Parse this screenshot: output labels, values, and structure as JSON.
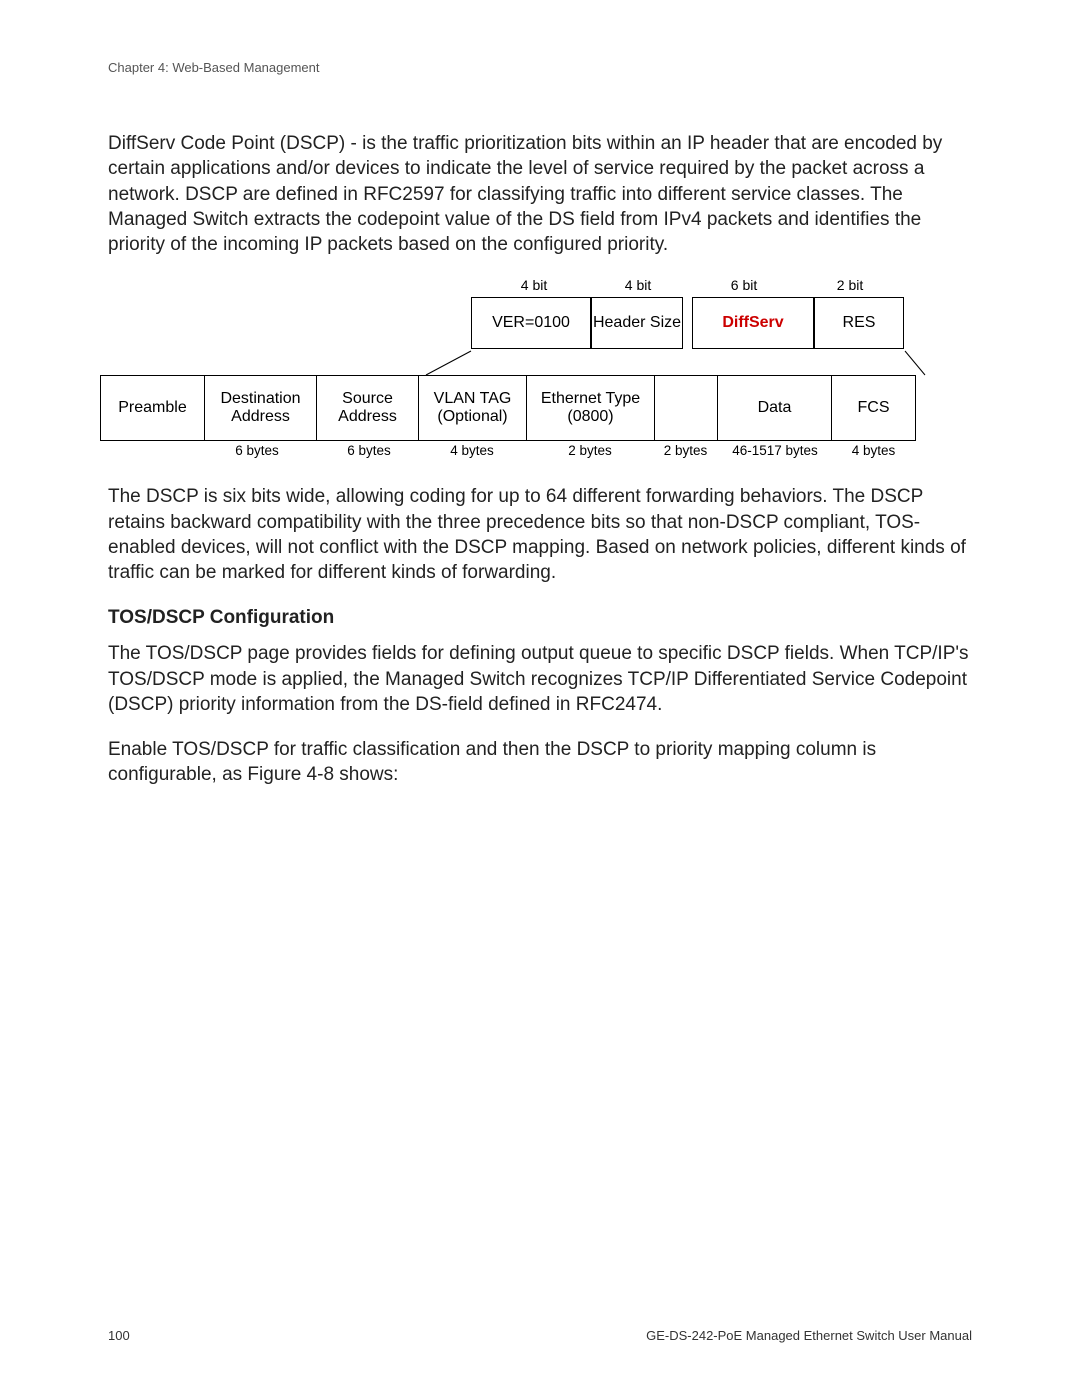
{
  "header": {
    "chapter": "Chapter 4: Web-Based Management"
  },
  "para1": "DiffServ Code Point (DSCP) - is the traffic prioritization bits within an IP header that are encoded by certain applications and/or devices to indicate the level of service required by the packet across a network. DSCP are defined in RFC2597 for classifying traffic into different service classes. The Managed Switch extracts the codepoint value of the DS field from IPv4 packets and identifies the priority of the incoming IP packets based on the configured priority.",
  "diagram": {
    "top_bits": {
      "a": "4 bit",
      "b": "4 bit",
      "c": "6 bit",
      "d": "2 bit"
    },
    "top_cells": {
      "ver": "VER=0100",
      "hsize": "Header Size",
      "ds": "DiffServ",
      "res": "RES"
    },
    "bottom_cells": {
      "pre": "Preamble",
      "dest": "Destination Address",
      "src": "Source Address",
      "vlan": "VLAN TAG (Optional)",
      "eth": "Ethernet Type (0800)",
      "data": "Data",
      "fcs": "FCS"
    },
    "bottom_bytes": {
      "dest": "6 bytes",
      "src": "6 bytes",
      "vlan": "4 bytes",
      "eth": "2 bytes",
      "gap": "2 bytes",
      "data": "46-1517 bytes",
      "fcs": "4 bytes"
    }
  },
  "para2": "The DSCP is six bits wide, allowing coding for up to 64 different forwarding behaviors. The DSCP retains backward compatibility with the three precedence bits so that non-DSCP compliant, TOS-enabled devices, will not conflict with the DSCP mapping. Based on network policies, different kinds of traffic can be marked for different kinds of forwarding.",
  "section_heading": "TOS/DSCP Configuration",
  "para3": "The TOS/DSCP page provides fields for defining output queue to specific DSCP fields. When TCP/IP's TOS/DSCP mode is applied, the Managed Switch recognizes TCP/IP Differentiated Service Codepoint (DSCP) priority information from the DS-field defined in RFC2474.",
  "para4": "Enable TOS/DSCP for traffic classification and then the DSCP to priority mapping column is configurable, as Figure 4-8 shows:",
  "footer": {
    "page": "100",
    "manual": "GE-DS-242-PoE Managed Ethernet Switch User Manual"
  }
}
